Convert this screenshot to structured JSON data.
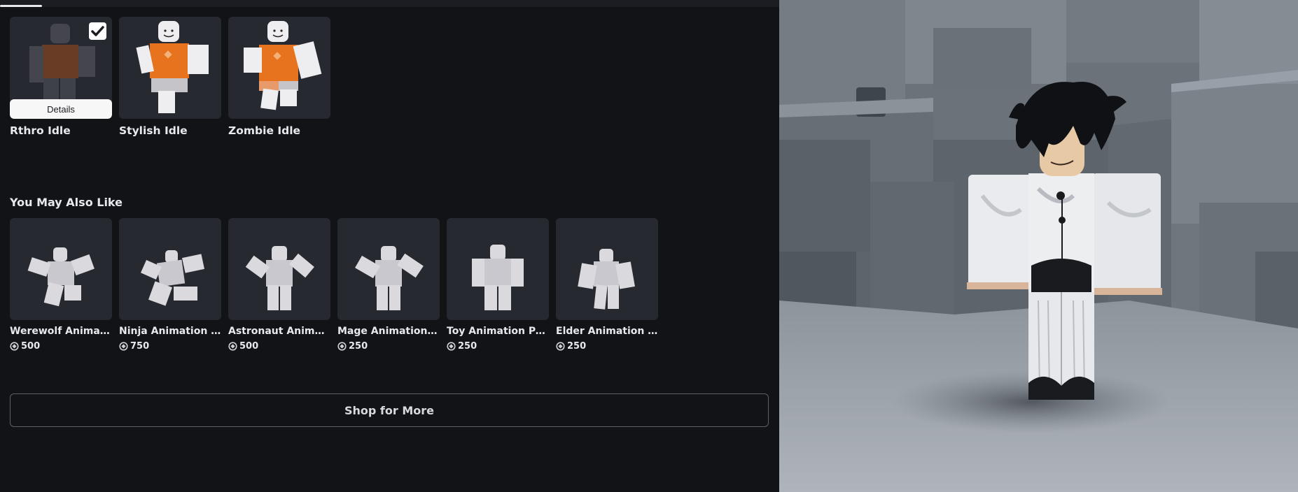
{
  "equipped_section": {
    "items": [
      {
        "name": "Rthro Idle",
        "details_label": "Details",
        "selected": true
      },
      {
        "name": "Stylish Idle"
      },
      {
        "name": "Zombie Idle"
      }
    ]
  },
  "recommendations": {
    "title": "You May Also Like",
    "items": [
      {
        "name": "Werewolf Animation Pack",
        "price": "500"
      },
      {
        "name": "Ninja Animation Pack",
        "price": "750"
      },
      {
        "name": "Astronaut Animation Pack",
        "price": "500"
      },
      {
        "name": "Mage Animation Pack",
        "price": "250"
      },
      {
        "name": "Toy Animation Pack",
        "price": "250"
      },
      {
        "name": "Elder Animation Pack",
        "price": "250"
      }
    ]
  },
  "shop_button": {
    "label": "Shop for More"
  },
  "icons": {
    "currency": "robux-icon",
    "selected": "checkmark-icon"
  },
  "colors": {
    "panel_bg": "#121317",
    "tile_bg": "#272930",
    "accent_orange": "#e8731e"
  }
}
